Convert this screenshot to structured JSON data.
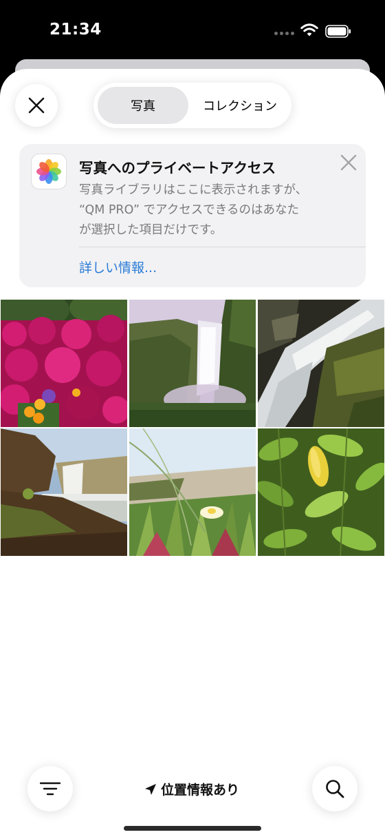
{
  "status": {
    "time": "21:34",
    "icons": [
      "cellular-dots-icon",
      "wifi-icon",
      "battery-icon"
    ]
  },
  "tabs": {
    "photos": "写真",
    "collections": "コレクション",
    "selected": "photos"
  },
  "banner": {
    "title": "写真へのプライベートアクセス",
    "body_lines": [
      "写真ライブラリはここに表示されますが、",
      "“QM PRO” でアクセスできるのはあなた",
      "が選択した項目だけです。"
    ],
    "link": "詳しい情報..."
  },
  "photos": [
    {
      "subject": "magenta-flowers"
    },
    {
      "subject": "waterfall-cliff"
    },
    {
      "subject": "waterfall-rocks"
    },
    {
      "subject": "waterfall-shore"
    },
    {
      "subject": "beach-flower"
    },
    {
      "subject": "green-leaves"
    }
  ],
  "bottom": {
    "location_label": "位置情報あり",
    "filter_icon": "filter-lines-icon",
    "search_icon": "magnifier-icon"
  },
  "colors": {
    "link": "#2a7bd6",
    "banner_bg": "#f2f2f4",
    "segment_active": "#e6e6e8"
  }
}
